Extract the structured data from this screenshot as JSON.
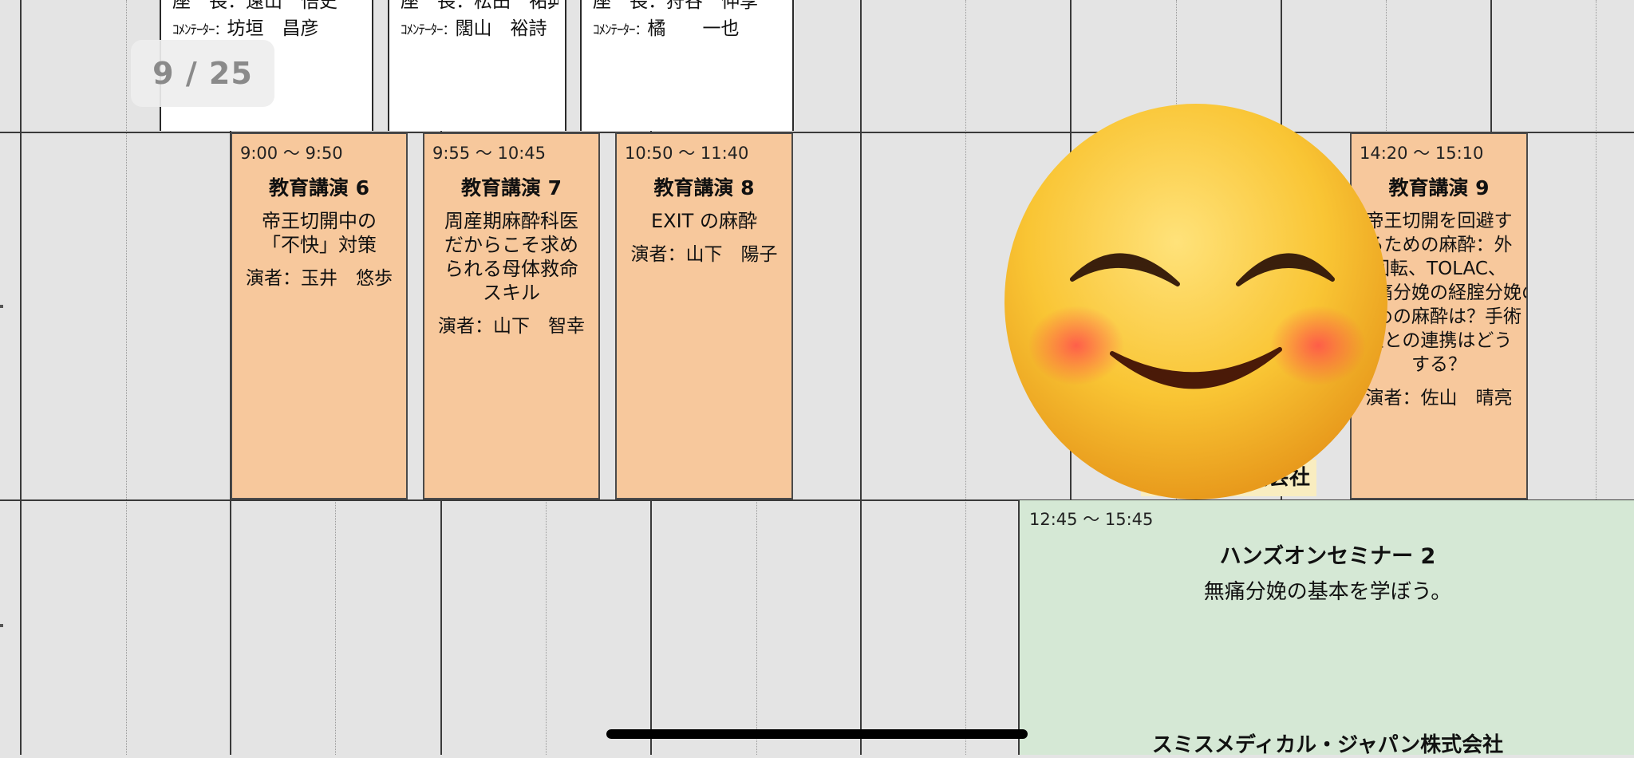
{
  "page_indicator": {
    "current": "9",
    "separator": "/",
    "total": "25",
    "text": "9 / 25"
  },
  "top_sessions": [
    {
      "chair_label": "座　長：",
      "chair": "遠山　悟史",
      "commentator_label": "ｺﾒﾝﾃｰﾀｰ：",
      "commentator": "坊垣　昌彦"
    },
    {
      "chair_label": "座　長：",
      "chair": "松田　祐典",
      "commentator_label": "ｺﾒﾝﾃｰﾀｰ：",
      "commentator": "闊山　裕詩"
    },
    {
      "chair_label": "座　長：",
      "chair": "狩谷　伸享",
      "commentator_label": "ｺﾒﾝﾃｰﾀｰ：",
      "commentator": "橘　　一也"
    }
  ],
  "lectures": [
    {
      "time": "9:00 ～ 9:50",
      "title": "教育講演 6",
      "topic_lines": [
        "帝王切開中の",
        "「不快」対策"
      ],
      "speaker": "演者：玉井　悠歩"
    },
    {
      "time": "9:55 ～ 10:45",
      "title": "教育講演 7",
      "topic_lines": [
        "周産期麻酔科医",
        "だからこそ求め",
        "られる母体救命",
        "スキル"
      ],
      "speaker": "演者：山下　智幸"
    },
    {
      "time": "10:50 ～ 11:40",
      "title": "教育講演 8",
      "topic_lines": [
        "EXIT の麻酔"
      ],
      "speaker": "演者：山下　陽子"
    },
    {
      "time": "14:20 ～ 15:10",
      "title": "教育講演 9",
      "topic_lines": [
        "帝王切開を回避す",
        "るための麻酔：外",
        "回転、TOLAC、",
        "無痛分娩の経腟分娩の",
        "ための麻酔は？手術",
        "室との連携はどう",
        "する？"
      ],
      "speaker": "演者：佐山　晴亮"
    }
  ],
  "sponsor_fragment": "式会社",
  "hands_on": {
    "time": "12:45 ～ 15:45",
    "title": "ハンズオンセミナー 2",
    "subtitle": "無痛分娩の基本を学ぼう。",
    "sponsor": "スミスメディカル・ジャパン株式会社"
  },
  "overlay": {
    "icon": "smiling-face-with-blush-icon"
  },
  "colors": {
    "lecture_bg": "#f7c89c",
    "handson_bg": "#d5e8d5",
    "grid_bg": "#e4e4e4",
    "sponsor_bg": "#f9edc0"
  }
}
